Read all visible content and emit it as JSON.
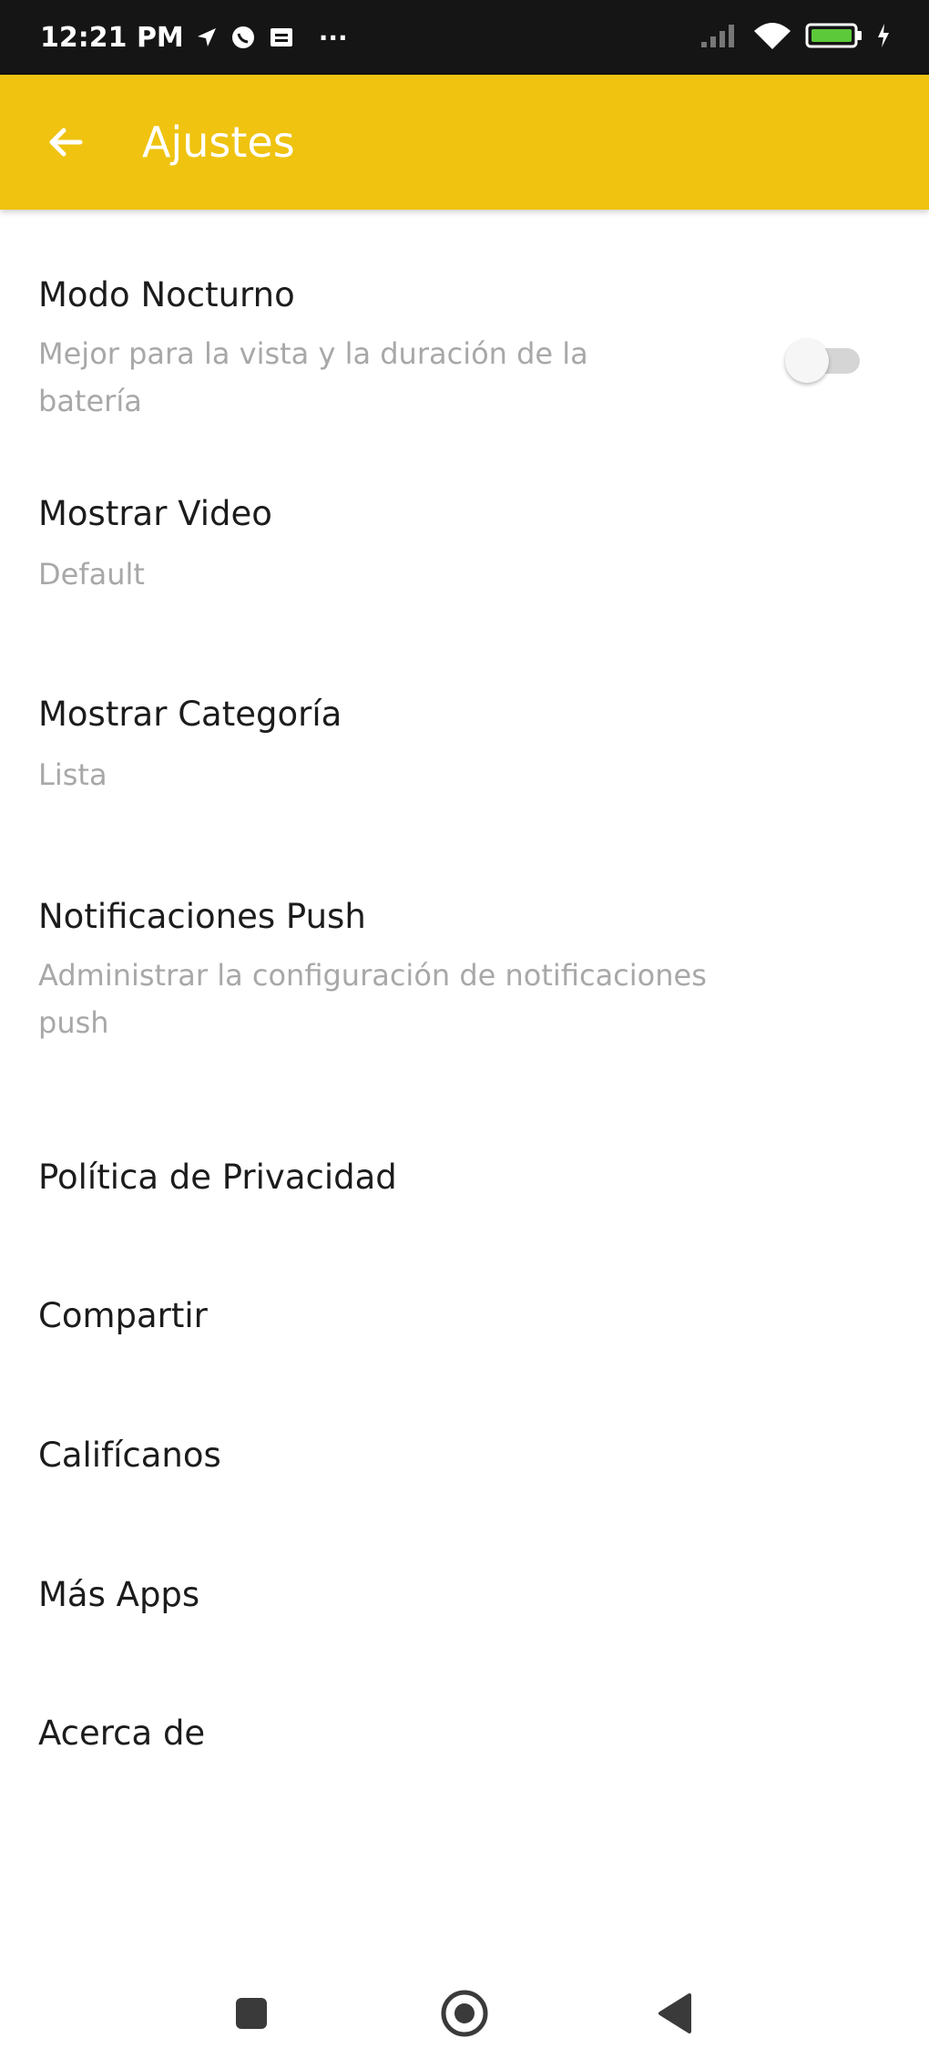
{
  "status_bar": {
    "time": "12:21 PM",
    "more": "···",
    "left_icons": [
      "navigation-icon",
      "whatsapp-icon",
      "message-icon"
    ],
    "right_icons": [
      "signal-icon",
      "wifi-icon",
      "battery-icon",
      "charging-icon"
    ]
  },
  "app_bar": {
    "title": "Ajustes",
    "back_icon": "arrow-left-icon"
  },
  "settings": {
    "items": [
      {
        "title": "Modo Nocturno",
        "subtitle_lines": [
          "Mejor para la vista y la duración de la",
          "batería"
        ],
        "toggle_on": false
      },
      {
        "title": "Mostrar Video",
        "subtitle_lines": [
          "Default"
        ]
      },
      {
        "title": "Mostrar Categoría",
        "subtitle_lines": [
          "Lista"
        ]
      },
      {
        "title": "Notificaciones Push",
        "subtitle_lines": [
          "Administrar la configuración de notificaciones",
          "push"
        ]
      },
      {
        "title": "Política de Privacidad"
      },
      {
        "title": "Compartir"
      },
      {
        "title": "Califícanos"
      },
      {
        "title": "Más Apps"
      },
      {
        "title": "Acerca de"
      }
    ]
  },
  "nav_bar": {
    "icons": [
      "recents-icon",
      "home-icon",
      "back-icon"
    ]
  },
  "colors": {
    "accent": "#efc30f",
    "status_bar": "#151515",
    "title_text": "#1c1c1c",
    "subtitle_text": "#a8a8a8"
  }
}
